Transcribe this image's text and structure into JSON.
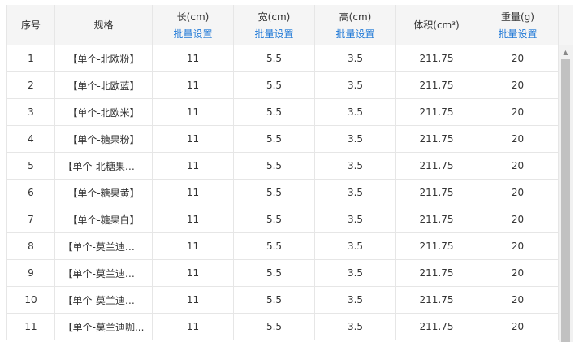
{
  "table": {
    "headers": [
      {
        "label": "序号",
        "batch": ""
      },
      {
        "label": "规格",
        "batch": ""
      },
      {
        "label": "长(cm)",
        "batch": "批量设置"
      },
      {
        "label": "宽(cm)",
        "batch": "批量设置"
      },
      {
        "label": "高(cm)",
        "batch": "批量设置"
      },
      {
        "label": "体积(cm³)",
        "batch": ""
      },
      {
        "label": "重量(g)",
        "batch": "批量设置"
      }
    ],
    "rows": [
      {
        "no": "1",
        "spec": "【单个-北欧粉】",
        "length": "11",
        "width": "5.5",
        "height": "3.5",
        "volume": "211.75",
        "weight": "20"
      },
      {
        "no": "2",
        "spec": "【单个-北欧蓝】",
        "length": "11",
        "width": "5.5",
        "height": "3.5",
        "volume": "211.75",
        "weight": "20"
      },
      {
        "no": "3",
        "spec": "【单个-北欧米】",
        "length": "11",
        "width": "5.5",
        "height": "3.5",
        "volume": "211.75",
        "weight": "20"
      },
      {
        "no": "4",
        "spec": "【单个-糖果粉】",
        "length": "11",
        "width": "5.5",
        "height": "3.5",
        "volume": "211.75",
        "weight": "20"
      },
      {
        "no": "5",
        "spec": "【单个-北糖果蓝】",
        "length": "11",
        "width": "5.5",
        "height": "3.5",
        "volume": "211.75",
        "weight": "20"
      },
      {
        "no": "6",
        "spec": "【单个-糖果黄】",
        "length": "11",
        "width": "5.5",
        "height": "3.5",
        "volume": "211.75",
        "weight": "20"
      },
      {
        "no": "7",
        "spec": "【单个-糖果白】",
        "length": "11",
        "width": "5.5",
        "height": "3.5",
        "volume": "211.75",
        "weight": "20"
      },
      {
        "no": "8",
        "spec": "【单个-莫兰迪紫】",
        "length": "11",
        "width": "5.5",
        "height": "3.5",
        "volume": "211.75",
        "weight": "20"
      },
      {
        "no": "9",
        "spec": "【单个-莫兰迪蓝】",
        "length": "11",
        "width": "5.5",
        "height": "3.5",
        "volume": "211.75",
        "weight": "20"
      },
      {
        "no": "10",
        "spec": "【单个-莫兰迪黄】",
        "length": "11",
        "width": "5.5",
        "height": "3.5",
        "volume": "211.75",
        "weight": "20"
      },
      {
        "no": "11",
        "spec": "【单个-莫兰迪咖...",
        "length": "11",
        "width": "5.5",
        "height": "3.5",
        "volume": "211.75",
        "weight": "20"
      }
    ]
  },
  "colors": {
    "link": "#1e78d6",
    "header_bg": "#f5f5f5",
    "border": "#e6e6e6"
  }
}
